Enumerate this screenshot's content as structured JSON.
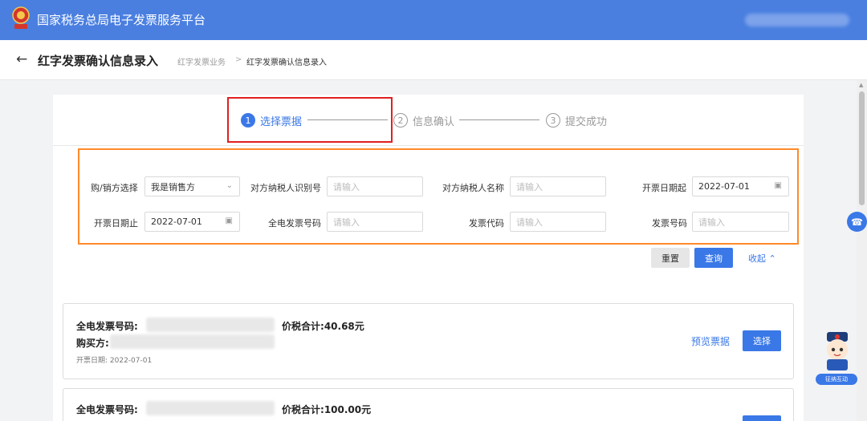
{
  "header": {
    "app_title": "国家税务总局电子发票服务平台",
    "brand_color": "#4a7fe0"
  },
  "page": {
    "title": "红字发票确认信息录入",
    "breadcrumb": [
      "红字发票业务",
      "红字发票确认信息录入"
    ],
    "breadcrumb_separator": ">"
  },
  "steps": [
    {
      "num": "1",
      "label": "选择票据",
      "active": true
    },
    {
      "num": "2",
      "label": "信息确认",
      "active": false
    },
    {
      "num": "3",
      "label": "提交成功",
      "active": false
    }
  ],
  "filters": {
    "buyer_seller": {
      "label": "购/销方选择",
      "value": "我是销售方"
    },
    "counterparty_tax_id": {
      "label": "对方纳税人识别号",
      "placeholder": "请输入"
    },
    "counterparty_name": {
      "label": "对方纳税人名称",
      "placeholder": "请输入"
    },
    "date_from": {
      "label": "开票日期起",
      "value": "2022-07-01"
    },
    "date_to": {
      "label": "开票日期止",
      "value": "2022-07-01"
    },
    "einvoice_number": {
      "label": "全电发票号码",
      "placeholder": "请输入"
    },
    "invoice_code": {
      "label": "发票代码",
      "placeholder": "请输入"
    },
    "invoice_number": {
      "label": "发票号码",
      "placeholder": "请输入"
    }
  },
  "actions": {
    "reset": "重置",
    "query": "查询",
    "collapse": "收起"
  },
  "invoices": [
    {
      "number_label": "全电发票号码:",
      "total_label": "价税合计:",
      "total_value": "40.68元",
      "buyer_label": "购买方:",
      "date_text": "开票日期: 2022-07-01",
      "preview": "预览票据",
      "select": "选择"
    },
    {
      "number_label": "全电发票号码:",
      "total_label": "价税合计:",
      "total_value": "100.00元"
    }
  ],
  "float_widget": {
    "label": "征纳互动"
  },
  "colors": {
    "accent": "#3a78e7",
    "highlight_red": "#e02020",
    "highlight_orange": "#ff8a2a"
  }
}
